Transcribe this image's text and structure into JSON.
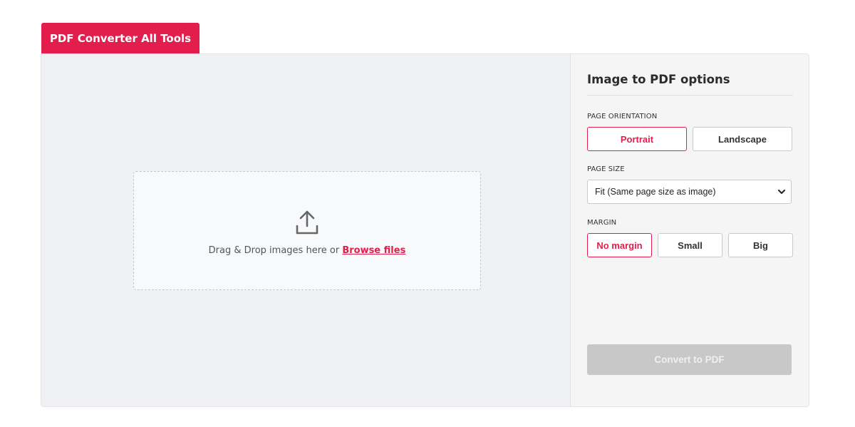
{
  "tab": {
    "label": "PDF Converter All Tools"
  },
  "dropzone": {
    "text": "Drag & Drop images here or ",
    "link": "Browse files"
  },
  "options": {
    "title": "Image to PDF options",
    "orientation": {
      "label": "PAGE ORIENTATION",
      "portrait": "Portrait",
      "landscape": "Landscape",
      "selected": "Portrait"
    },
    "page_size": {
      "label": "PAGE SIZE",
      "value": "Fit (Same page size as image)"
    },
    "margin": {
      "label": "MARGIN",
      "none": "No margin",
      "small": "Small",
      "big": "Big",
      "selected": "No margin"
    },
    "convert": "Convert to PDF"
  },
  "colors": {
    "accent": "#e31e4c",
    "disabled_button": "#c8c8c8",
    "drop_bg": "#eff1f4"
  },
  "icons": {
    "upload": "upload-icon",
    "select_chevron": "chevron-down-icon"
  }
}
